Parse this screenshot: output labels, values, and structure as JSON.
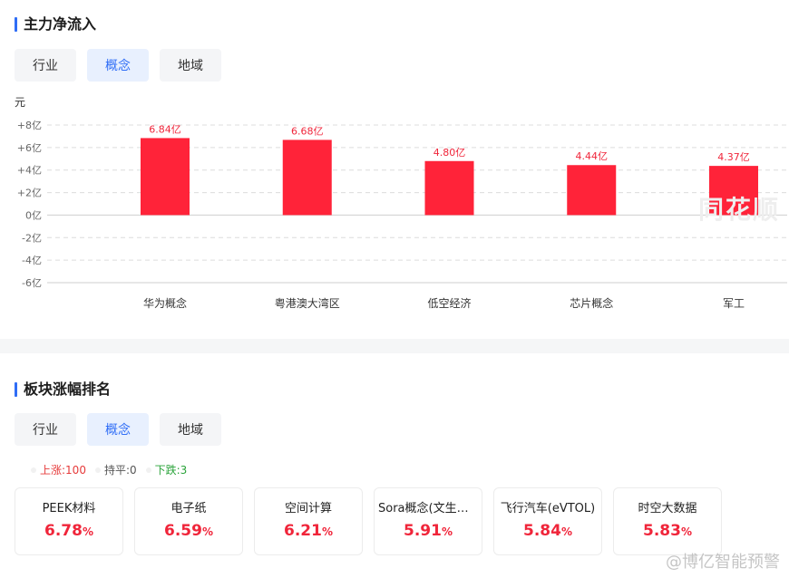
{
  "section1": {
    "title": "主力净流入",
    "tabs": [
      {
        "label": "行业",
        "active": false
      },
      {
        "label": "概念",
        "active": true
      },
      {
        "label": "地域",
        "active": false
      }
    ]
  },
  "chart_data": {
    "type": "bar",
    "ylabel": "元",
    "yticks": [
      "+8亿",
      "+6亿",
      "+4亿",
      "+2亿",
      "0亿",
      "-2亿",
      "-4亿",
      "-6亿"
    ],
    "ylim": [
      -6,
      8
    ],
    "categories": [
      "华为概念",
      "粤港澳大湾区",
      "低空经济",
      "芯片概念",
      "军工"
    ],
    "values": [
      6.84,
      6.68,
      4.8,
      4.44,
      4.37
    ],
    "value_labels": [
      "6.84亿",
      "6.68亿",
      "4.80亿",
      "4.44亿",
      "4.37亿"
    ],
    "grid": true,
    "bar_color": "#ff2339"
  },
  "chart_watermark": "同花顺",
  "section2": {
    "title": "板块涨幅排名",
    "tabs": [
      {
        "label": "行业",
        "active": false
      },
      {
        "label": "概念",
        "active": true
      },
      {
        "label": "地域",
        "active": false
      }
    ],
    "stats": {
      "up": "上涨:100",
      "flat": "持平:0",
      "down": "下跌:3"
    },
    "cards": [
      {
        "name": "PEEK材料",
        "value": "6.78",
        "unit": "%"
      },
      {
        "name": "电子纸",
        "value": "6.59",
        "unit": "%"
      },
      {
        "name": "空间计算",
        "value": "6.21",
        "unit": "%"
      },
      {
        "name": "Sora概念(文生视频)",
        "value": "5.91",
        "unit": "%"
      },
      {
        "name": "飞行汽车(eVTOL)",
        "value": "5.84",
        "unit": "%"
      },
      {
        "name": "时空大数据",
        "value": "5.83",
        "unit": "%"
      }
    ]
  },
  "watermark": "@博亿智能预警",
  "colors": {
    "accent": "#2f6df6",
    "up": "#f0253a",
    "down": "#2aa33a"
  }
}
